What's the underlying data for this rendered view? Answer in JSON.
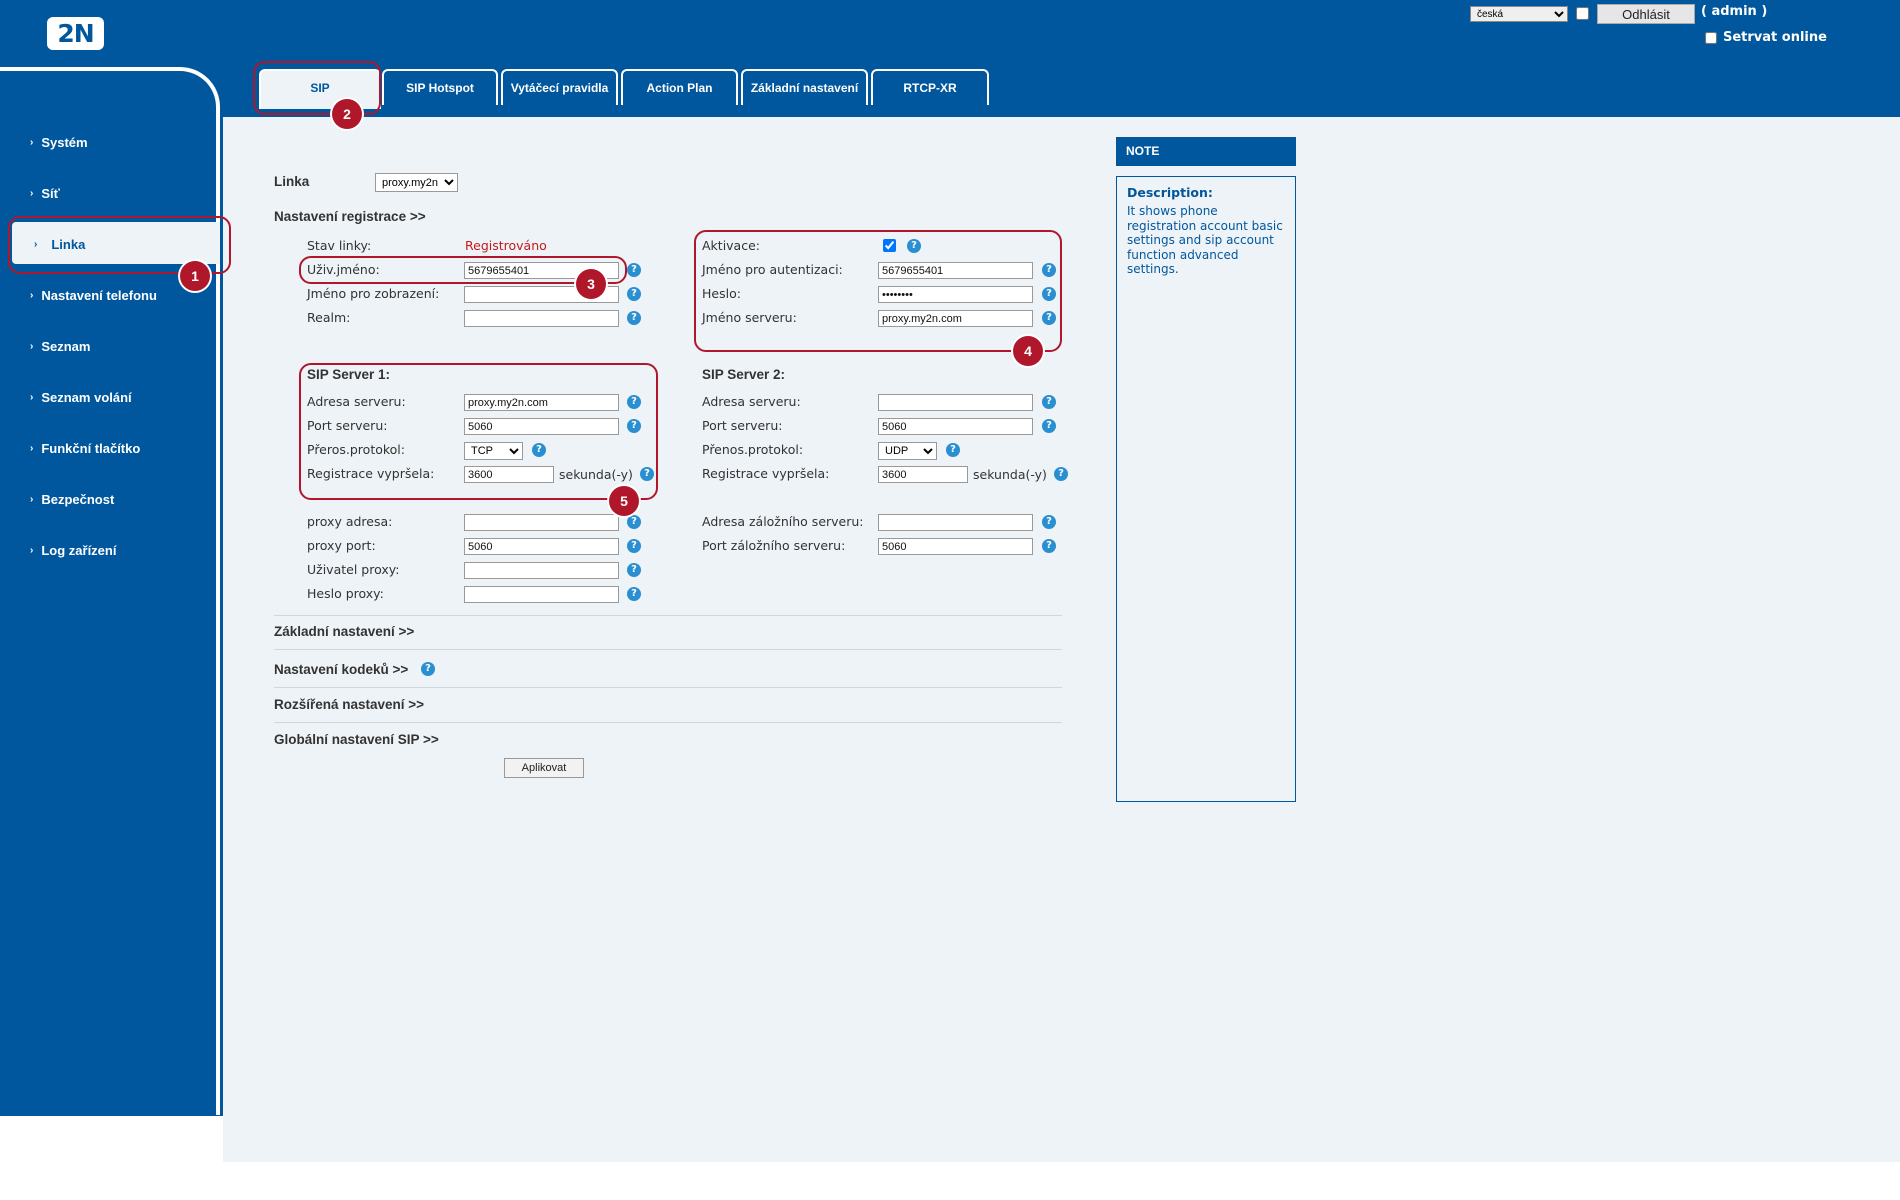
{
  "header": {
    "logo": "2N",
    "language": "česká",
    "logout_label": "Odhlásit",
    "user_label": "( admin )",
    "stay_online_label": "Setrvat online"
  },
  "tabs": [
    {
      "label": "SIP",
      "active": true
    },
    {
      "label": "SIP Hotspot"
    },
    {
      "label": "Vytáčecí pravidla"
    },
    {
      "label": "Action Plan"
    },
    {
      "label": "Základní nastavení"
    },
    {
      "label": "RTCP-XR"
    }
  ],
  "sidebar": {
    "items": [
      {
        "label": "Systém"
      },
      {
        "label": "Síť"
      },
      {
        "label": "Linka",
        "active": true
      },
      {
        "label": "Nastavení telefonu"
      },
      {
        "label": "Seznam"
      },
      {
        "label": "Seznam volání"
      },
      {
        "label": "Funkční tlačítko"
      },
      {
        "label": "Bezpečnost"
      },
      {
        "label": "Log zařízení"
      }
    ]
  },
  "form": {
    "line_label": "Linka",
    "line_value": "proxy.my2n",
    "registration_header": "Nastavení registrace >>",
    "line_status_label": "Stav linky:",
    "line_status_value": "Registrováno",
    "username_label": "Uživ.jméno:",
    "username_value": "5679655401",
    "display_name_label": "Jméno pro zobrazení:",
    "display_name_value": "",
    "realm_label": "Realm:",
    "realm_value": "",
    "activation_label": "Aktivace:",
    "activation_checked": true,
    "auth_name_label": "Jméno pro autentizaci:",
    "auth_name_value": "5679655401",
    "password_label": "Heslo:",
    "password_value": "••••••••",
    "server_name_label": "Jméno serveru:",
    "server_name_value": "proxy.my2n.com",
    "sip_server1": {
      "title": "SIP Server 1:",
      "address_label": "Adresa serveru:",
      "address_value": "proxy.my2n.com",
      "port_label": "Port serveru:",
      "port_value": "5060",
      "protocol_label": "Přeros.protokol:",
      "protocol_value": "TCP",
      "expiry_label": "Registrace vypršela:",
      "expiry_value": "3600",
      "expiry_unit": "sekunda(-y)"
    },
    "sip_server2": {
      "title": "SIP Server 2:",
      "address_label": "Adresa serveru:",
      "address_value": "",
      "port_label": "Port serveru:",
      "port_value": "5060",
      "protocol_label": "Přenos.protokol:",
      "protocol_value": "UDP",
      "expiry_label": "Registrace vypršela:",
      "expiry_value": "3600",
      "expiry_unit": "sekunda(-y)"
    },
    "proxy_address_label": "proxy adresa:",
    "proxy_address_value": "",
    "proxy_port_label": "proxy port:",
    "proxy_port_value": "5060",
    "proxy_user_label": "Uživatel proxy:",
    "proxy_user_value": "",
    "proxy_password_label": "Heslo proxy:",
    "proxy_password_value": "",
    "backup_address_label": "Adresa záložního serveru:",
    "backup_address_value": "",
    "backup_port_label": "Port záložního serveru:",
    "backup_port_value": "5060",
    "basic_settings_link": "Základní nastavení >>",
    "codec_settings_link": "Nastavení kodeků >>",
    "advanced_settings_link": "Rozšířená nastavení >>",
    "global_sip_link": "Globální nastavení SIP >>",
    "apply_label": "Aplikovat"
  },
  "note": {
    "header": "NOTE",
    "desc_title": "Description:",
    "desc_text": "It shows phone registration account basic settings and sip account function advanced settings."
  },
  "callouts": [
    "1",
    "2",
    "3",
    "4",
    "5"
  ],
  "colors": {
    "brand_blue": "#00579d",
    "content_bg": "#eef3f7",
    "callout_red": "#b0172b",
    "status_red": "#c41a1a",
    "help_blue": "#2a8fd0"
  }
}
